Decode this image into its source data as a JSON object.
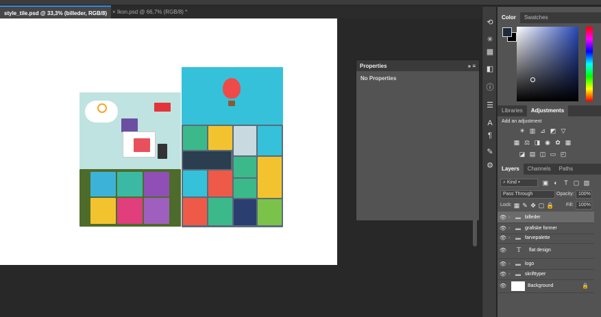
{
  "tabs": [
    {
      "label": "style_tile.psd @ 33,3% (billeder, RGB/8)",
      "active": true
    },
    {
      "label": "Ikon.psd @ 66,7% (RGB/8) *",
      "active": false
    }
  ],
  "tab_close_glyph": "×",
  "properties": {
    "title": "Properties",
    "empty_text": "No Properties",
    "collapse_glyph": "»",
    "menu_glyph": "≡"
  },
  "color_panel": {
    "tabs": [
      "Color",
      "Swatches"
    ],
    "foreground": "#1c2a3a",
    "background": "#000000"
  },
  "adjustments_panel": {
    "tabs": [
      "Libraries",
      "Adjustments"
    ],
    "heading": "Add an adjustment"
  },
  "layers_panel": {
    "tabs": [
      "Layers",
      "Channels",
      "Paths"
    ],
    "filter": "Kind",
    "blend_mode": "Pass Through",
    "opacity_label": "Opacity:",
    "opacity": "100%",
    "lock_label": "Lock:",
    "fill_label": "Fill:",
    "fill": "100%",
    "layers": [
      {
        "name": "billeder",
        "type": "group",
        "selected": true
      },
      {
        "name": "grafiske former",
        "type": "group"
      },
      {
        "name": "farvepalette",
        "type": "group"
      },
      {
        "name": "flat design",
        "type": "text"
      },
      {
        "name": "logo",
        "type": "group"
      },
      {
        "name": "skrifttyper",
        "type": "group"
      },
      {
        "name": "Background",
        "type": "background"
      }
    ]
  },
  "icons": [
    "history-icon",
    "brush-settings-icon",
    "libraries-icon",
    "adjustments-icon",
    "info-icon",
    "properties-icon",
    "character-icon",
    "paragraph-icon",
    "tool-presets-icon",
    "clone-source-icon"
  ],
  "colors": {
    "accent": "#2d8ceb",
    "panel": "#535353",
    "dark": "#282828"
  }
}
